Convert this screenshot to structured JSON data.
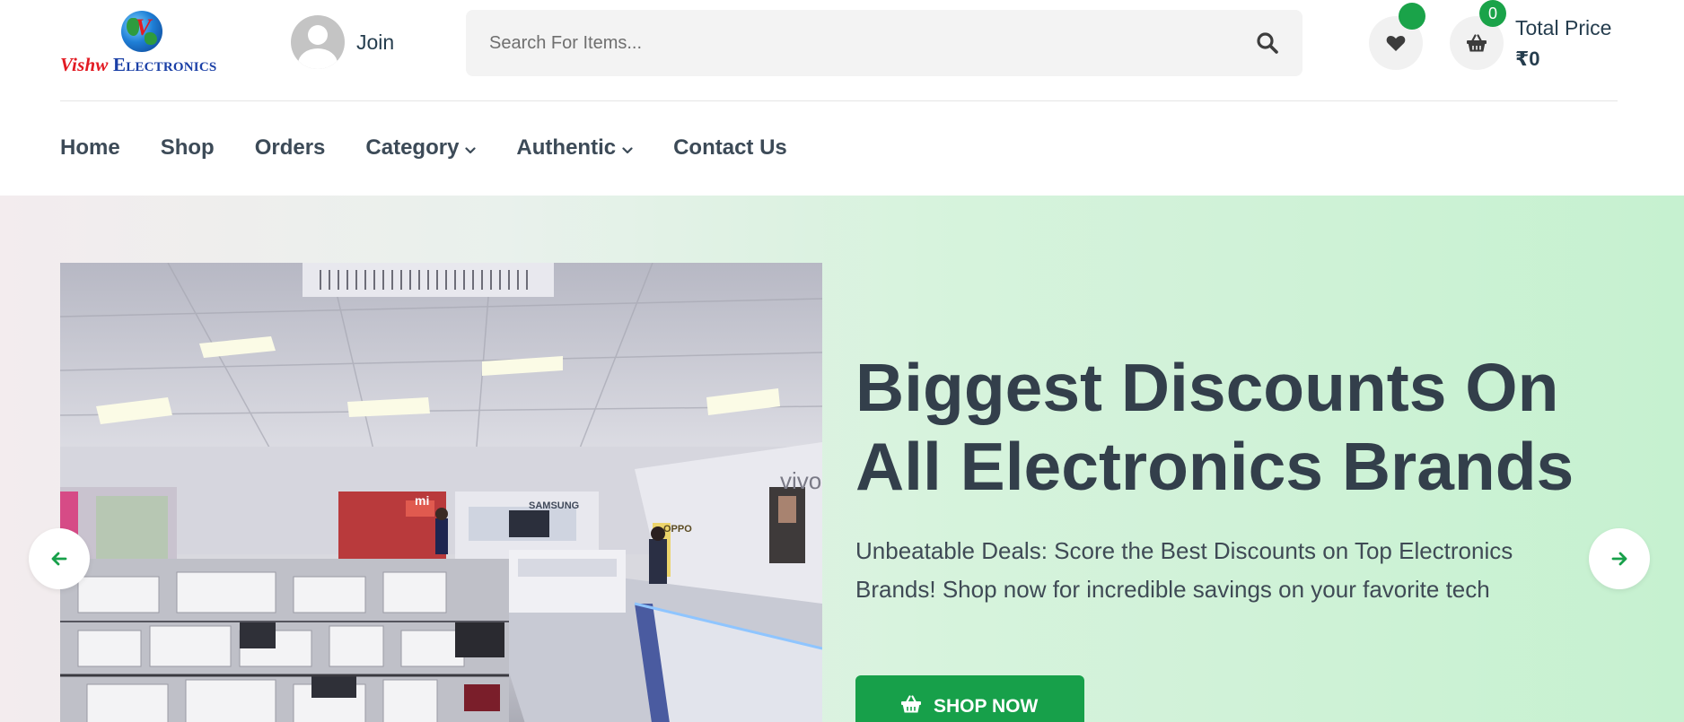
{
  "brand": {
    "logo_alt": "Vishw Electronics",
    "logo_word1": "Vishw",
    "logo_word2": "Electronics",
    "logo_mark": "V"
  },
  "header": {
    "join_label": "Join",
    "search": {
      "placeholder": "Search For Items...",
      "value": ""
    },
    "wishlist": {
      "icon": "heart-icon",
      "badge": ""
    },
    "cart": {
      "icon": "basket-icon",
      "badge": "0"
    },
    "total_price_label": "Total Price",
    "total_price_value": "₹0"
  },
  "nav": {
    "items": [
      {
        "label": "Home",
        "dropdown": false
      },
      {
        "label": "Shop",
        "dropdown": false
      },
      {
        "label": "Orders",
        "dropdown": false
      },
      {
        "label": "Category",
        "dropdown": true
      },
      {
        "label": "Authentic",
        "dropdown": true
      },
      {
        "label": "Contact Us",
        "dropdown": false
      }
    ]
  },
  "hero": {
    "title_line1": "Biggest Discounts On",
    "title_line2": "All Electronics Brands",
    "subtitle": "Unbeatable Deals: Score the Best Discounts on Top Electronics Brands! Shop now for incredible savings on your favorite tech",
    "cta_label": "SHOP NOW",
    "image_alt": "Electronics showroom interior",
    "store_signs": [
      "mi",
      "SAMSUNG",
      "vivo",
      "OPPO"
    ]
  },
  "colors": {
    "accent": "#17a04a",
    "badge": "#1aa349",
    "text_dark": "#253d4e",
    "logo_red": "#e21b23",
    "logo_blue": "#1a3fa6"
  }
}
